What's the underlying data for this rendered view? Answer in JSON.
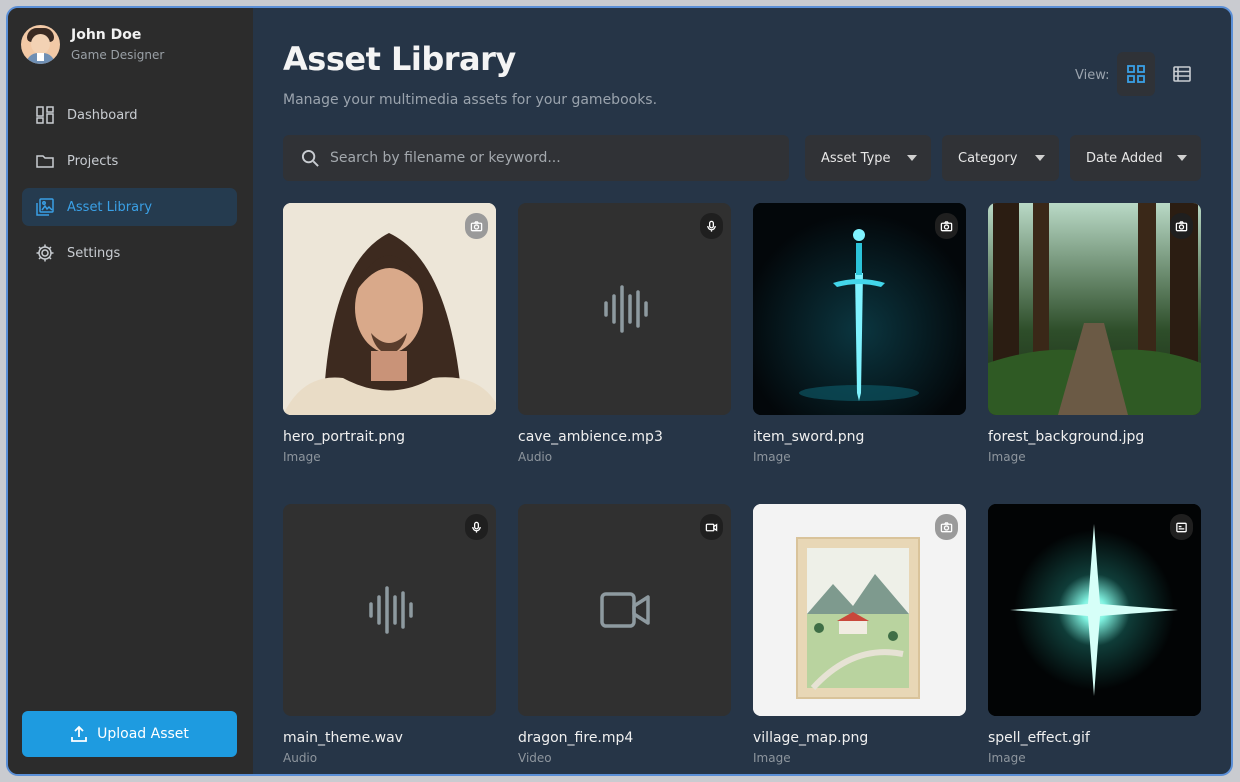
{
  "user": {
    "name": "John Doe",
    "role": "Game Designer"
  },
  "nav": {
    "items": [
      {
        "label": "Dashboard",
        "icon": "dashboard-icon",
        "active": false
      },
      {
        "label": "Projects",
        "icon": "folder-icon",
        "active": false
      },
      {
        "label": "Asset Library",
        "icon": "image-library-icon",
        "active": true
      },
      {
        "label": "Settings",
        "icon": "gear-icon",
        "active": false
      }
    ]
  },
  "upload_button": {
    "label": "Upload Asset",
    "icon": "upload-icon"
  },
  "header": {
    "title": "Asset Library",
    "subtitle": "Manage your multimedia assets for your gamebooks.",
    "view_label": "View:",
    "view_mode": "grid"
  },
  "search": {
    "placeholder": "Search by filename or keyword..."
  },
  "filters": [
    "Asset Type",
    "Category",
    "Date Added"
  ],
  "assets": [
    {
      "name": "hero_portrait.png",
      "type": "Image",
      "badge": "camera-icon",
      "preview": "portrait"
    },
    {
      "name": "cave_ambience.mp3",
      "type": "Audio",
      "badge": "microphone-icon",
      "preview": "audio-wave-icon"
    },
    {
      "name": "item_sword.png",
      "type": "Image",
      "badge": "camera-icon",
      "preview": "sword"
    },
    {
      "name": "forest_background.jpg",
      "type": "Image",
      "badge": "camera-icon",
      "preview": "forest"
    },
    {
      "name": "main_theme.wav",
      "type": "Audio",
      "badge": "microphone-icon",
      "preview": "audio-wave-icon"
    },
    {
      "name": "dragon_fire.mp4",
      "type": "Video",
      "badge": "video-camera-icon",
      "preview": "video-camera-icon"
    },
    {
      "name": "village_map.png",
      "type": "Image",
      "badge": "camera-icon",
      "preview": "framed-landscape"
    },
    {
      "name": "spell_effect.gif",
      "type": "Image",
      "badge": "gif-icon",
      "preview": "starburst"
    }
  ],
  "colors": {
    "accent": "#1e9be0",
    "sidebar_bg": "#2c2c2c",
    "main_bg": "#263547"
  }
}
